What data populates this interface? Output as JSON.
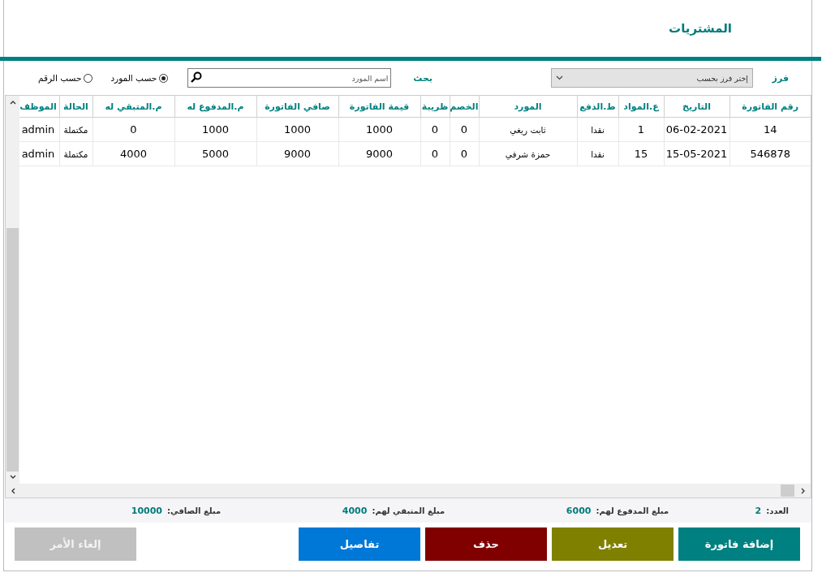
{
  "title": "المشتريات",
  "sort": {
    "label": "فرز",
    "placeholder": "إختر فرز بحسب"
  },
  "search": {
    "label": "بحث",
    "placeholder": "اسم المورد"
  },
  "radios": [
    {
      "label": "حسب المورد",
      "selected": true
    },
    {
      "label": "حسب الرقم",
      "selected": false
    }
  ],
  "table": {
    "columns": [
      "رقم الفاتورة",
      "التاريخ",
      "ع.المواد",
      "ط.الدفع",
      "المورد",
      "الخصم",
      "ظريبة",
      "قيمة الفاتورة",
      "صافي الفاتورة",
      "م.المدفوع له",
      "م.المتبقي له",
      "الحالة",
      "الموظف"
    ],
    "rows": [
      [
        "14",
        "06-02-2021",
        "1",
        "نقدا",
        "ثابت ريغي",
        "0",
        "0",
        "1000",
        "1000",
        "1000",
        "0",
        "مكتملة",
        "admin"
      ],
      [
        "546878",
        "15-05-2021",
        "15",
        "نقدا",
        "حمزة شرفي",
        "0",
        "0",
        "9000",
        "9000",
        "5000",
        "4000",
        "مكتملة",
        "admin"
      ]
    ]
  },
  "summary": [
    {
      "label": "العدد:",
      "value": "2"
    },
    {
      "label": "مبلغ المدفوع لهم:",
      "value": "6000"
    },
    {
      "label": "مبلغ المتبقي لهم:",
      "value": "4000"
    },
    {
      "label": "مبلغ الصافي:",
      "value": "10000"
    }
  ],
  "buttons": [
    {
      "label": "إضافة فاتورة",
      "color": "#008080",
      "disabled": false
    },
    {
      "label": "تعديل",
      "color": "#808000",
      "disabled": false
    },
    {
      "label": "حذف",
      "color": "#800000",
      "disabled": false
    },
    {
      "label": "تفاصيل",
      "color": "#0078d7",
      "disabled": false
    },
    {
      "label": "إلغاء الأمر",
      "color": "#c0c0c0",
      "disabled": true
    }
  ]
}
